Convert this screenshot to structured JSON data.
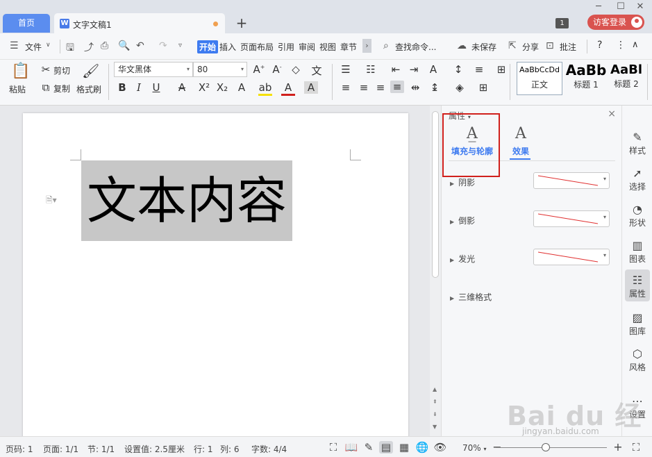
{
  "tabs": {
    "home_label": "首页",
    "doc_icon": "W",
    "doc_title": "文字文稿1",
    "new_tab": "+",
    "badge": "1",
    "login_label": "访客登录"
  },
  "window_controls": {
    "minimize": "─",
    "maximize": "☐",
    "close": "✕"
  },
  "menu": {
    "file": "文件",
    "items": [
      "开始",
      "插入",
      "页面布局",
      "引用",
      "审阅",
      "视图",
      "章节"
    ],
    "more": "›",
    "search": "查找命令...",
    "unsaved": "未保存",
    "share": "分享",
    "comment": "批注",
    "help": "?",
    "more_menu": "⋮",
    "collapse": "∧"
  },
  "ribbon": {
    "paste": "粘贴",
    "cut": "剪切",
    "copy": "复制",
    "format_painter": "格式刷",
    "font_name": "华文黑体",
    "font_size": "80",
    "styles": [
      {
        "preview": "AaBbCcDd",
        "name": "正文"
      },
      {
        "preview": "AaBb",
        "name": "标题 1"
      },
      {
        "preview": "AaBl",
        "name": "标题 2"
      }
    ]
  },
  "document": {
    "text": "文本内容"
  },
  "panel": {
    "title": "属性",
    "close": "×",
    "tab_fill": "填充与轮廓",
    "tab_effect": "效果",
    "rows": [
      "阴影",
      "倒影",
      "发光",
      "三维格式"
    ]
  },
  "rail": {
    "items": [
      "样式",
      "选择",
      "形状",
      "图表",
      "属性",
      "图库",
      "风格",
      "设置"
    ]
  },
  "status": {
    "page": "页码: 1",
    "pages": "页面: 1/1",
    "section": "节: 1/1",
    "setting": "设置值: 2.5厘米",
    "row": "行: 1",
    "col": "列: 6",
    "words": "字数: 4/4",
    "zoom": "70%",
    "zoom_level": 0.45
  },
  "watermark": {
    "logo": "Bai du 经验",
    "url": "jingyan.baidu.com"
  },
  "colors": {
    "accent": "#3e7bf0",
    "home_tab": "#5b8def",
    "login": "#d9534f",
    "highlight": "#d0201c",
    "selection": "#c7c7c7"
  }
}
